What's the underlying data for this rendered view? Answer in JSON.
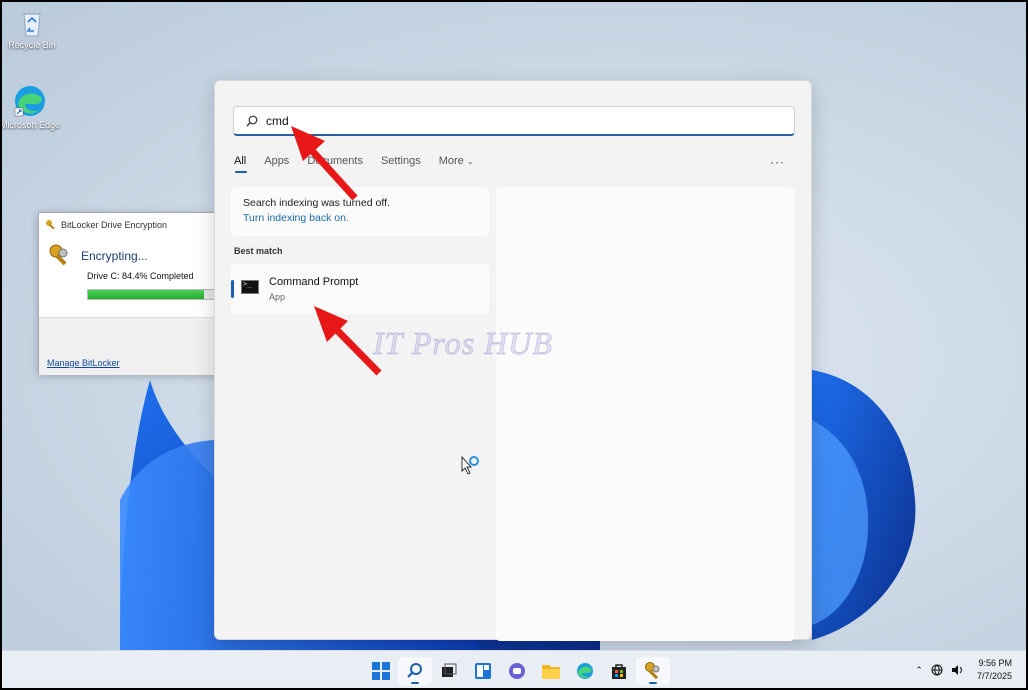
{
  "desktop": {
    "icons": [
      {
        "label": "Recycle Bin",
        "icon": "recycle-bin-icon"
      },
      {
        "label": "Microsoft Edge",
        "icon": "edge-icon"
      }
    ]
  },
  "bitlocker": {
    "title": "BitLocker Drive Encryption",
    "heading": "Encrypting...",
    "status": "Drive C: 84.4% Completed",
    "progress_percent": 84.4,
    "link": "Manage BitLocker"
  },
  "search": {
    "query": "cmd",
    "tabs": [
      "All",
      "Apps",
      "Documents",
      "Settings",
      "More"
    ],
    "active_tab": "All",
    "more_options": "···",
    "notice_text": "Search indexing was turned off.",
    "notice_link": "Turn indexing back on.",
    "best_match_label": "Best match",
    "result": {
      "title": "Command Prompt",
      "subtitle": "App"
    }
  },
  "watermark": "IT Pros HUB",
  "taskbar": {
    "apps": [
      "start-icon",
      "search-icon",
      "task-view-icon",
      "widgets-icon",
      "chat-icon",
      "file-explorer-icon",
      "edge-icon",
      "store-icon",
      "bitlocker-icon"
    ],
    "time": "9:56 PM",
    "date": "7/7/2025"
  },
  "colors": {
    "accent": "#1f5fb0",
    "arrow": "#e81818",
    "progress": "#1fae2a"
  }
}
